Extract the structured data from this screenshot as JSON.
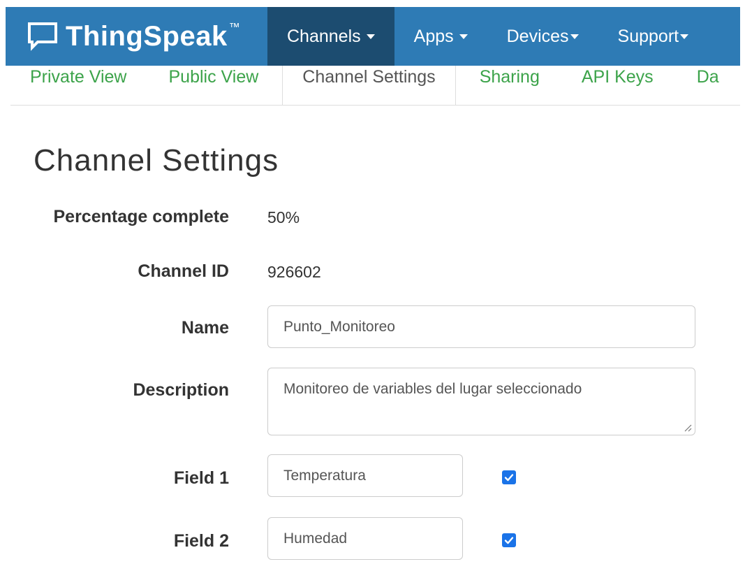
{
  "navbar": {
    "brand": "ThingSpeak",
    "trademark": "™",
    "items": [
      {
        "label": "Channels",
        "active": true
      },
      {
        "label": "Apps",
        "active": false
      },
      {
        "label": "Devices",
        "active": false
      },
      {
        "label": "Support",
        "active": false
      }
    ]
  },
  "tabs": [
    {
      "label": "Private View",
      "active": false
    },
    {
      "label": "Public View",
      "active": false
    },
    {
      "label": "Channel Settings",
      "active": true
    },
    {
      "label": "Sharing",
      "active": false
    },
    {
      "label": "API Keys",
      "active": false
    },
    {
      "label": "Da",
      "active": false
    }
  ],
  "page": {
    "title": "Channel Settings"
  },
  "form": {
    "percentage": {
      "label": "Percentage complete",
      "value": "50%"
    },
    "channel_id": {
      "label": "Channel ID",
      "value": "926602"
    },
    "name": {
      "label": "Name",
      "value": "Punto_Monitoreo"
    },
    "description": {
      "label": "Description",
      "value": "Monitoreo de variables del lugar seleccionado"
    },
    "field1": {
      "label": "Field 1",
      "value": "Temperatura",
      "checked": true
    },
    "field2": {
      "label": "Field 2",
      "value": "Humedad",
      "checked": true
    }
  },
  "colors": {
    "navbar": "#2e7bb5",
    "navbar_active": "#1c4c70",
    "tab_link": "#3ca34a",
    "checkbox": "#1a73e8"
  }
}
